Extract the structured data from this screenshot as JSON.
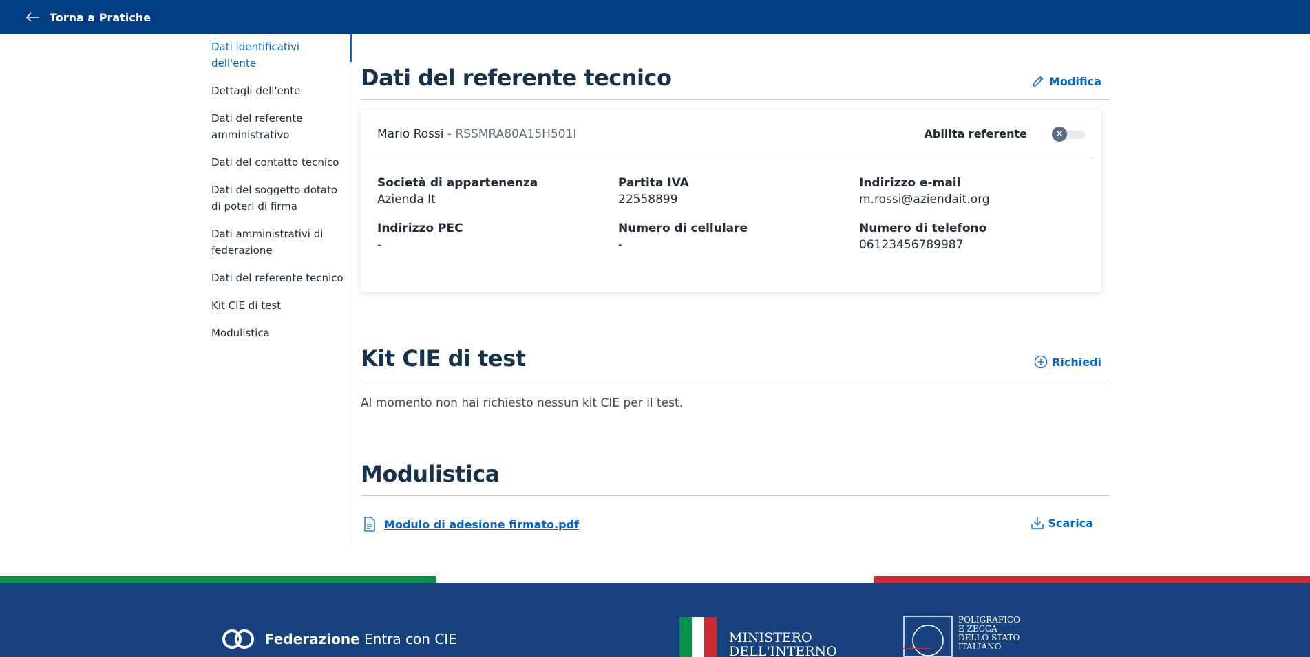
{
  "topbar": {
    "back_label": "Torna a Pratiche"
  },
  "sidebar": {
    "items": [
      {
        "label": "Dati identificativi dell'ente",
        "active": true
      },
      {
        "label": "Dettagli dell'ente"
      },
      {
        "label": "Dati del referente amministrativo"
      },
      {
        "label": "Dati del contatto tecnico"
      },
      {
        "label": "Dati del soggetto dotato di poteri di firma"
      },
      {
        "label": "Dati amministrativi di federazione"
      },
      {
        "label": "Dati del referente tecnico"
      },
      {
        "label": "Kit CIE di test"
      },
      {
        "label": "Modulistica"
      }
    ]
  },
  "referente": {
    "title": "Dati del referente tecnico",
    "edit_label": "Modifica",
    "name": "Mario Rossi",
    "separator": " - ",
    "fiscal_code": "RSSMRA80A15H501I",
    "toggle_label": "Abilita referente",
    "toggle_enabled": false,
    "fields": [
      {
        "label": "Società di appartenenza",
        "value": "Azienda It"
      },
      {
        "label": "Partita IVA",
        "value": "22558899"
      },
      {
        "label": "Indirizzo e-mail",
        "value": "m.rossi@aziendait.org"
      },
      {
        "label": "Indirizzo PEC",
        "value": "-"
      },
      {
        "label": "Numero di cellulare",
        "value": "-"
      },
      {
        "label": "Numero di telefono",
        "value": "06123456789987"
      }
    ]
  },
  "kit": {
    "title": "Kit CIE di test",
    "request_label": "Richiedi",
    "empty_message": "Al momento non hai richiesto nessun kit CIE per il test."
  },
  "modulistica": {
    "title": "Modulistica",
    "file_name": "Modulo di adesione firmato.pdf",
    "download_label": "Scarica"
  },
  "footer": {
    "fed_bold": "Federazione",
    "fed_rest": " Entra con CIE",
    "ministero_line1": "MINISTERO",
    "ministero_line2": "DELL'INTERNO",
    "ipzs_lines": [
      "POLIGRAFICO",
      "E ZECCA",
      "DELLO STATO",
      "ITALIANO"
    ]
  },
  "colors": {
    "header_bg": "#003d85",
    "footer_bg": "#17427d",
    "link": "#0066cc",
    "flag_green": "#00924a",
    "flag_white": "#ffffff",
    "flag_red": "#ce2b37"
  }
}
